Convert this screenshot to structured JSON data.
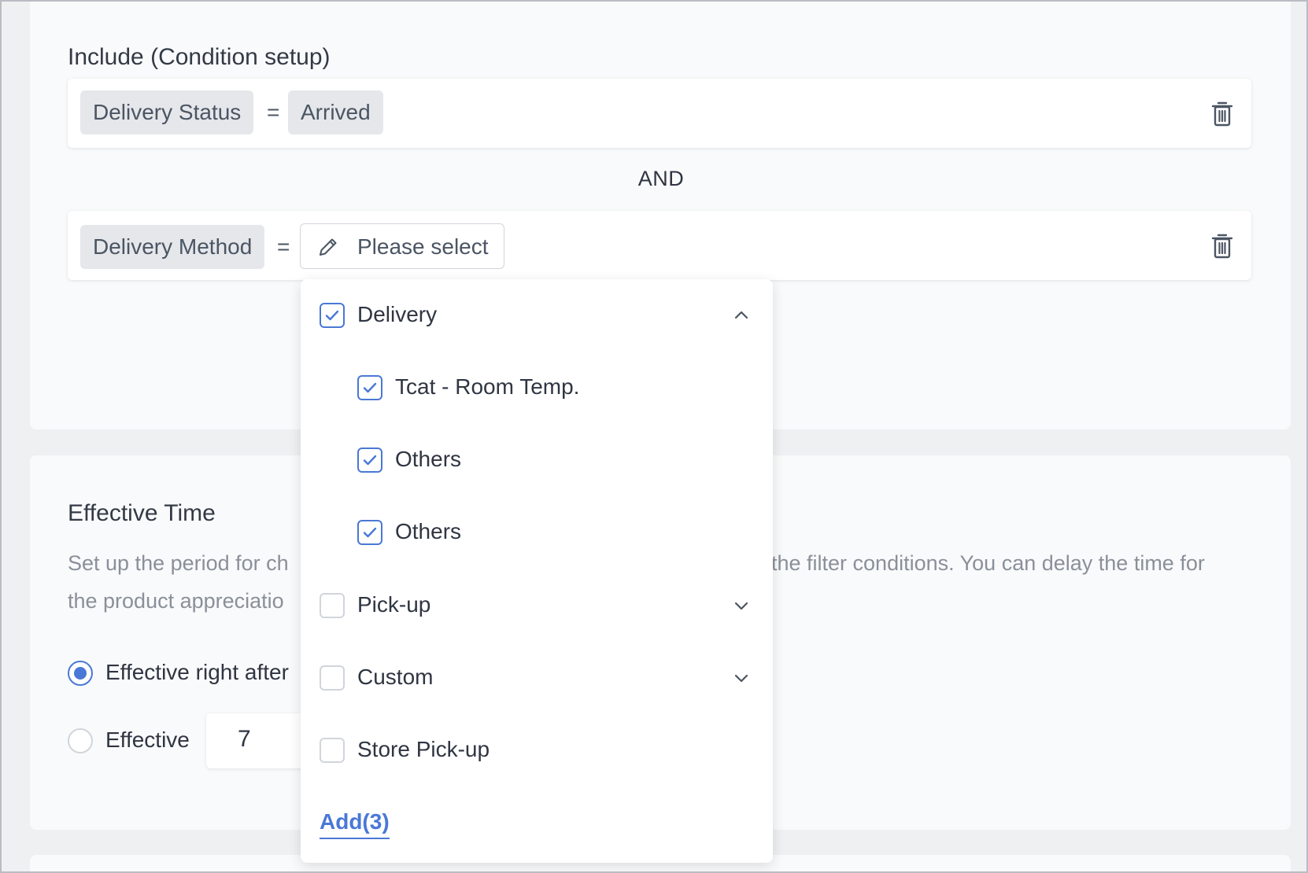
{
  "include_section": {
    "title": "Include (Condition setup)",
    "condition1": {
      "field": "Delivery Status",
      "operator": "=",
      "value": "Arrived"
    },
    "connector": "AND",
    "condition2": {
      "field": "Delivery Method",
      "operator": "=",
      "placeholder": "Please select"
    }
  },
  "dropdown": {
    "groups": [
      {
        "label": "Delivery",
        "checked": true,
        "expanded": true,
        "children": [
          {
            "label": "Tcat - Room Temp.",
            "checked": true
          },
          {
            "label": "Others",
            "checked": true
          },
          {
            "label": "Others",
            "checked": true
          }
        ]
      },
      {
        "label": "Pick-up",
        "checked": false,
        "expanded": false
      },
      {
        "label": "Custom",
        "checked": false,
        "expanded": false
      },
      {
        "label": "Store Pick-up",
        "checked": false
      }
    ],
    "add_label": "Add(3)"
  },
  "effective_section": {
    "title": "Effective Time",
    "desc_line1_left": "Set up the period for ch",
    "desc_line1_right": "the filter conditions. You can delay the time for",
    "desc_line2_left": "the product appreciatio",
    "option1_label": "Effective right after",
    "option2_label": "Effective",
    "days_value": "7"
  },
  "colors": {
    "accent": "#4a78d6",
    "tag_bg": "#e5e7eb",
    "page_bg": "#eef0f2"
  }
}
